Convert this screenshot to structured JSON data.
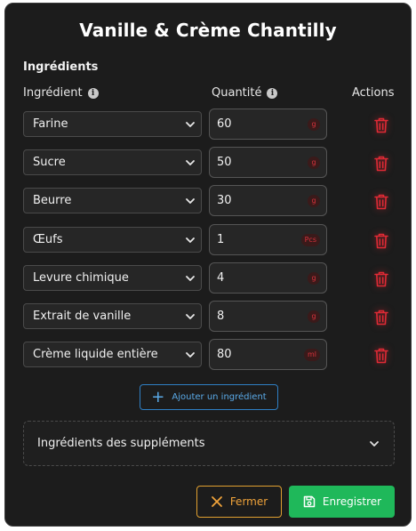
{
  "dialog": {
    "title": "Vanille & Crème Chantilly",
    "section_title": "Ingrédients",
    "columns": {
      "ingredient": "Ingrédient",
      "quantity": "Quantité",
      "actions": "Actions"
    },
    "rows": [
      {
        "ingredient": "Farine",
        "quantity": "60",
        "unit": "g"
      },
      {
        "ingredient": "Sucre",
        "quantity": "50",
        "unit": "g"
      },
      {
        "ingredient": "Beurre",
        "quantity": "30",
        "unit": "g"
      },
      {
        "ingredient": "Œufs",
        "quantity": "1",
        "unit": "Pcs"
      },
      {
        "ingredient": "Levure chimique",
        "quantity": "4",
        "unit": "g"
      },
      {
        "ingredient": "Extrait de vanille",
        "quantity": "8",
        "unit": "g"
      },
      {
        "ingredient": "Crème liquide entière",
        "quantity": "80",
        "unit": "ml"
      }
    ],
    "add_ingredient_label": "Ajouter un ingrédient",
    "supplements_label": "Ingrédients des suppléments",
    "close_label": "Fermer",
    "save_label": "Enregistrer"
  },
  "colors": {
    "background": "#1c1c1c",
    "delete": "#e02a35",
    "add": "#2f7fc4",
    "close": "#e0a030",
    "save": "#1fb85a"
  },
  "icons": {
    "info": "info-icon",
    "chevron": "chevron-down-icon",
    "delete": "trash-icon",
    "add": "plus-icon",
    "close": "close-icon",
    "save": "save-icon"
  }
}
